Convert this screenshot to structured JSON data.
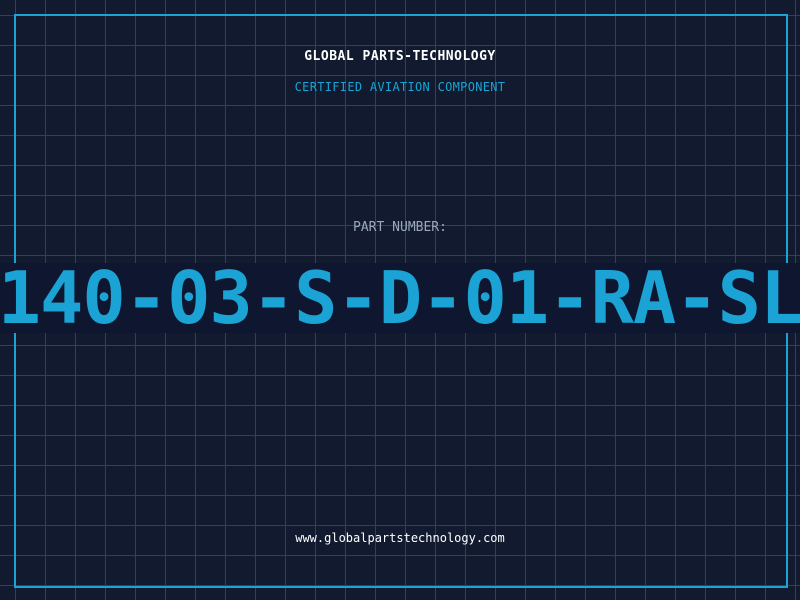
{
  "header": {
    "title": "GLOBAL PARTS-TECHNOLOGY",
    "subtitle": "CERTIFIED AVIATION COMPONENT"
  },
  "part": {
    "label": "PART NUMBER:",
    "number": "140-03-S-D-01-RA-SL"
  },
  "footer": {
    "url": "www.globalpartstechnology.com"
  },
  "colors": {
    "background": "#111a2e",
    "grid": "#1e4a5e",
    "accent": "#1aa3d4",
    "band": "#0f1730"
  }
}
